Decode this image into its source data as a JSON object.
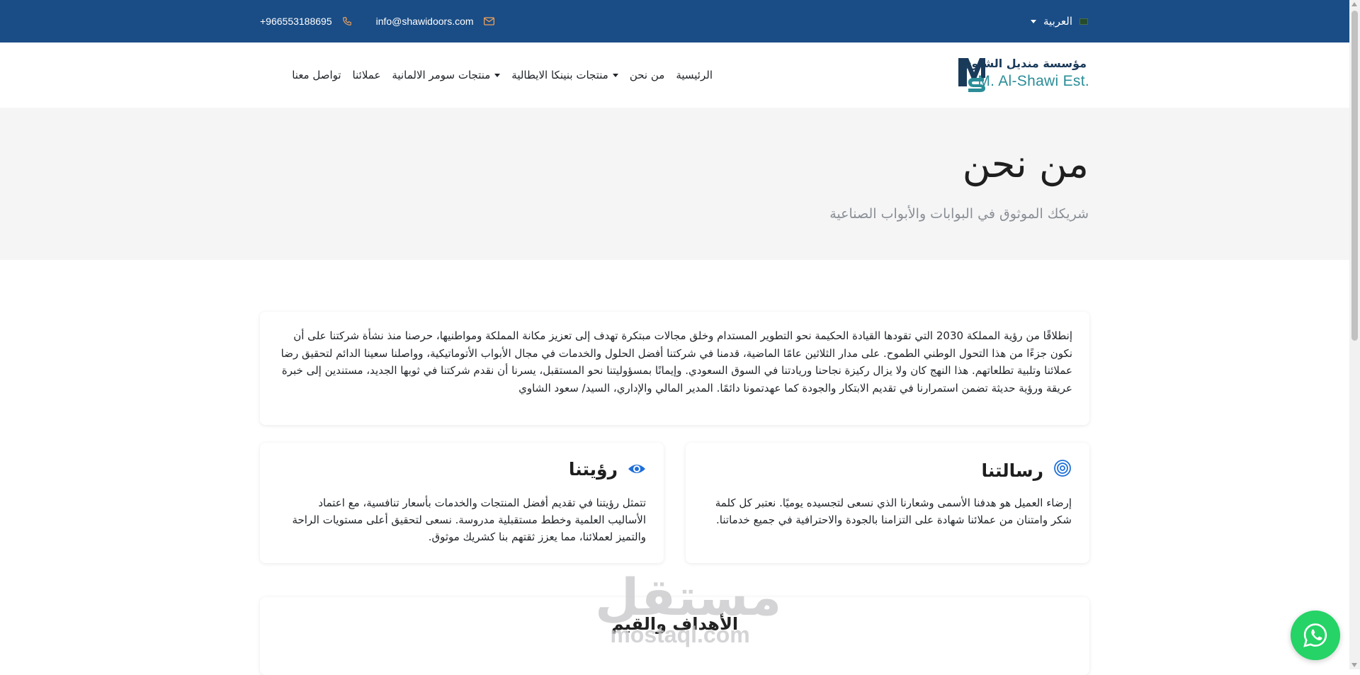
{
  "topbar": {
    "phone": "+966553188695",
    "email": "info@shawidoors.com",
    "language": "العربية",
    "phone_icon": "phone-icon",
    "email_icon": "envelope-icon",
    "flag_icon": "flag-icon"
  },
  "logo": {
    "name_ar": "مؤسسة منديل الشاوي",
    "name_en": "M. Al-Shawi Est.",
    "mark_letters": "MS"
  },
  "nav": {
    "items": [
      {
        "label": "الرئيسية",
        "dropdown": false
      },
      {
        "label": "من نحن",
        "dropdown": false
      },
      {
        "label": "منتجات بنينكا الايطالية",
        "dropdown": true
      },
      {
        "label": "منتجات سومر الالمانية",
        "dropdown": true
      },
      {
        "label": "عملائنا",
        "dropdown": false
      },
      {
        "label": "تواصل معنا",
        "dropdown": false
      }
    ]
  },
  "hero": {
    "title": "من نحن",
    "subtitle": "شريكك الموثوق في البوابات والأبواب الصناعية"
  },
  "about": {
    "text": "إنطلاقًا من رؤية المملكة 2030 التي تقودها القيادة الحكيمة نحو التطوير المستدام وخلق مجالات مبتكرة تهدف إلى تعزيز مكانة المملكة ومواطنيها، حرصنا منذ نشأة شركتنا على أن نكون جزءًا من هذا التحول الوطني الطموح. على مدار الثلاثين عامًا الماضية، قدمنا في شركتنا أفضل الحلول والخدمات في مجال الأبواب الأتوماتيكية، وواصلنا سعينا الدائم لتحقيق رضا عملائنا وتلبية تطلعاتهم. هذا النهج كان ولا يزال ركيزة نجاحنا وريادتنا في السوق السعودي. وإيمانًا بمسؤوليتنا نحو المستقبل، يسرنا أن نقدم شركتنا في ثوبها الجديد، مستندين إلى خبرة عريقة ورؤية حديثة تضمن استمرارنا في تقديم الابتكار والجودة كما عهدتمونا دائمًا. المدير المالي والإداري، السيد/ سعود الشاوي"
  },
  "mission": {
    "title": "رسالتنا",
    "icon": "bullseye-icon",
    "text": "إرضاء العميل هو هدفنا الأسمى وشعارنا الذي نسعى لتجسيده يوميًا. نعتبر كل كلمة شكر وامتنان من عملائنا شهادة على التزامنا بالجودة والاحترافية في جميع خدماتنا."
  },
  "vision": {
    "title": "رؤيتنا",
    "icon": "eye-icon",
    "text": "تتمثل رؤيتنا في تقديم أفضل المنتجات والخدمات بأسعار تنافسية، مع اعتماد الأساليب العلمية وخطط مستقبلية مدروسة. نسعى لتحقيق أعلى مستويات الراحة والتميز لعملائنا، مما يعزز ثقتهم بنا كشريك موثوق."
  },
  "goals": {
    "title": "الأهداف والقيم"
  },
  "watermark": {
    "ar": "مستقل",
    "en": "mostaql.com"
  },
  "floating": {
    "whatsapp_icon": "whatsapp-icon"
  },
  "colors": {
    "topbar": "#1a4d86",
    "accent": "#1f6fd9",
    "logo_teal": "#2a8d98",
    "whatsapp": "#25d366",
    "hero_bg": "#f5f5f6"
  }
}
